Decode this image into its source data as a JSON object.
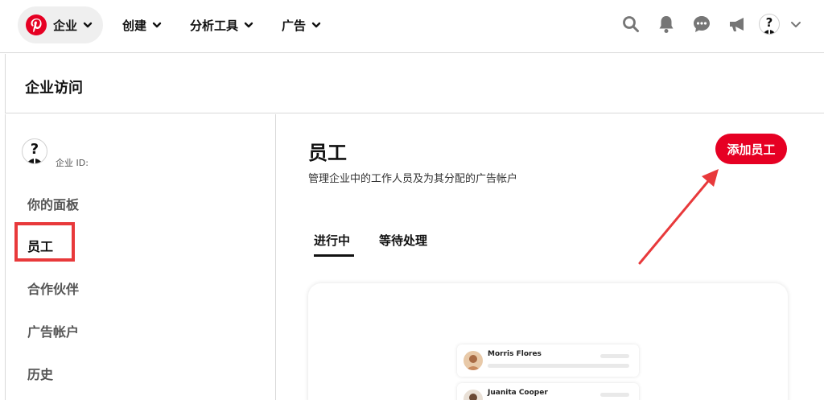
{
  "nav": {
    "business_label": "企业",
    "items": [
      {
        "label": "创建"
      },
      {
        "label": "分析工具"
      },
      {
        "label": "广告"
      }
    ],
    "icons": [
      "search-icon",
      "bell-icon",
      "message-icon",
      "megaphone-icon",
      "avatar",
      "chevron-down-icon"
    ]
  },
  "page": {
    "title": "企业访问"
  },
  "sidebar": {
    "business_id_label": "企业 ID:",
    "items": [
      {
        "label": "你的面板",
        "active": false
      },
      {
        "label": "员工",
        "active": true
      },
      {
        "label": "合作伙伴",
        "active": false
      },
      {
        "label": "广告帐户",
        "active": false
      },
      {
        "label": "历史",
        "active": false
      }
    ]
  },
  "main": {
    "title": "员工",
    "subtitle": "管理企业中的工作人员及为其分配的广告帐户",
    "add_button": "添加员工",
    "tabs": [
      {
        "label": "进行中",
        "active": true
      },
      {
        "label": "等待处理",
        "active": false
      }
    ],
    "preview_rows": [
      {
        "name": "Morris Flores"
      },
      {
        "name": "Juanita Cooper"
      }
    ]
  },
  "colors": {
    "brand_red": "#e60023",
    "annotation_red": "#e8393b"
  }
}
